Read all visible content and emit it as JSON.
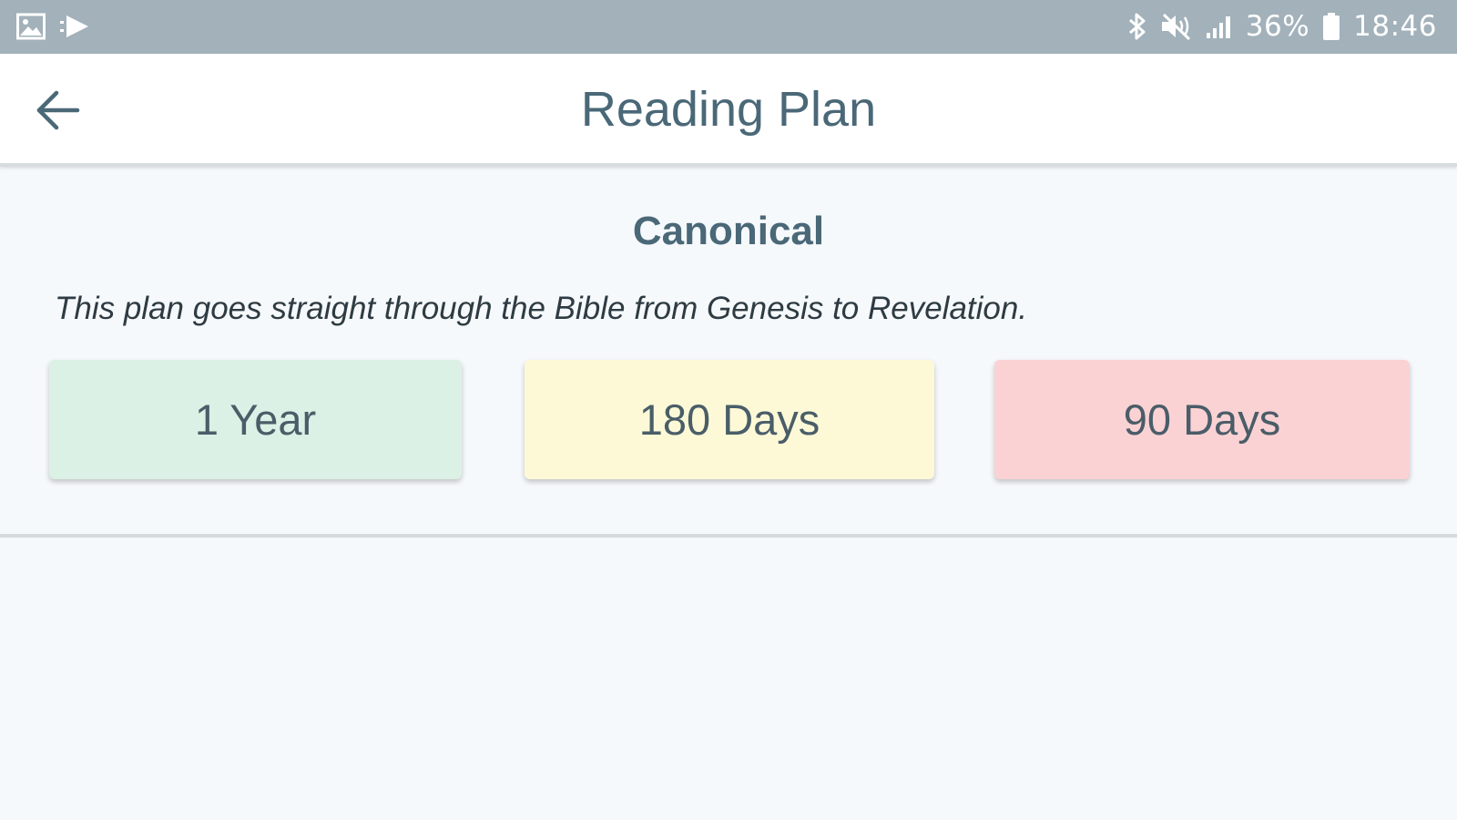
{
  "status_bar": {
    "left_icons": [
      "image-icon",
      "play-store-icon"
    ],
    "right_icons": [
      "bluetooth-icon",
      "mute-icon",
      "signal-icon",
      "battery-icon"
    ],
    "battery_percent": "36%",
    "time": "18:46",
    "background_color": "#a2b1ba"
  },
  "app_bar": {
    "back_icon": "arrow-back-icon",
    "title": "Reading Plan"
  },
  "plan": {
    "heading": "Canonical",
    "description": "This plan goes straight through the Bible from Genesis to Revelation.",
    "options": [
      {
        "label": "1 Year",
        "color": "#dcf1e5"
      },
      {
        "label": "180 Days",
        "color": "#fdf9d7"
      },
      {
        "label": "90 Days",
        "color": "#fbd2d4"
      }
    ]
  },
  "colors": {
    "accent_text": "#4a6877",
    "background": "#f6f9fc"
  }
}
